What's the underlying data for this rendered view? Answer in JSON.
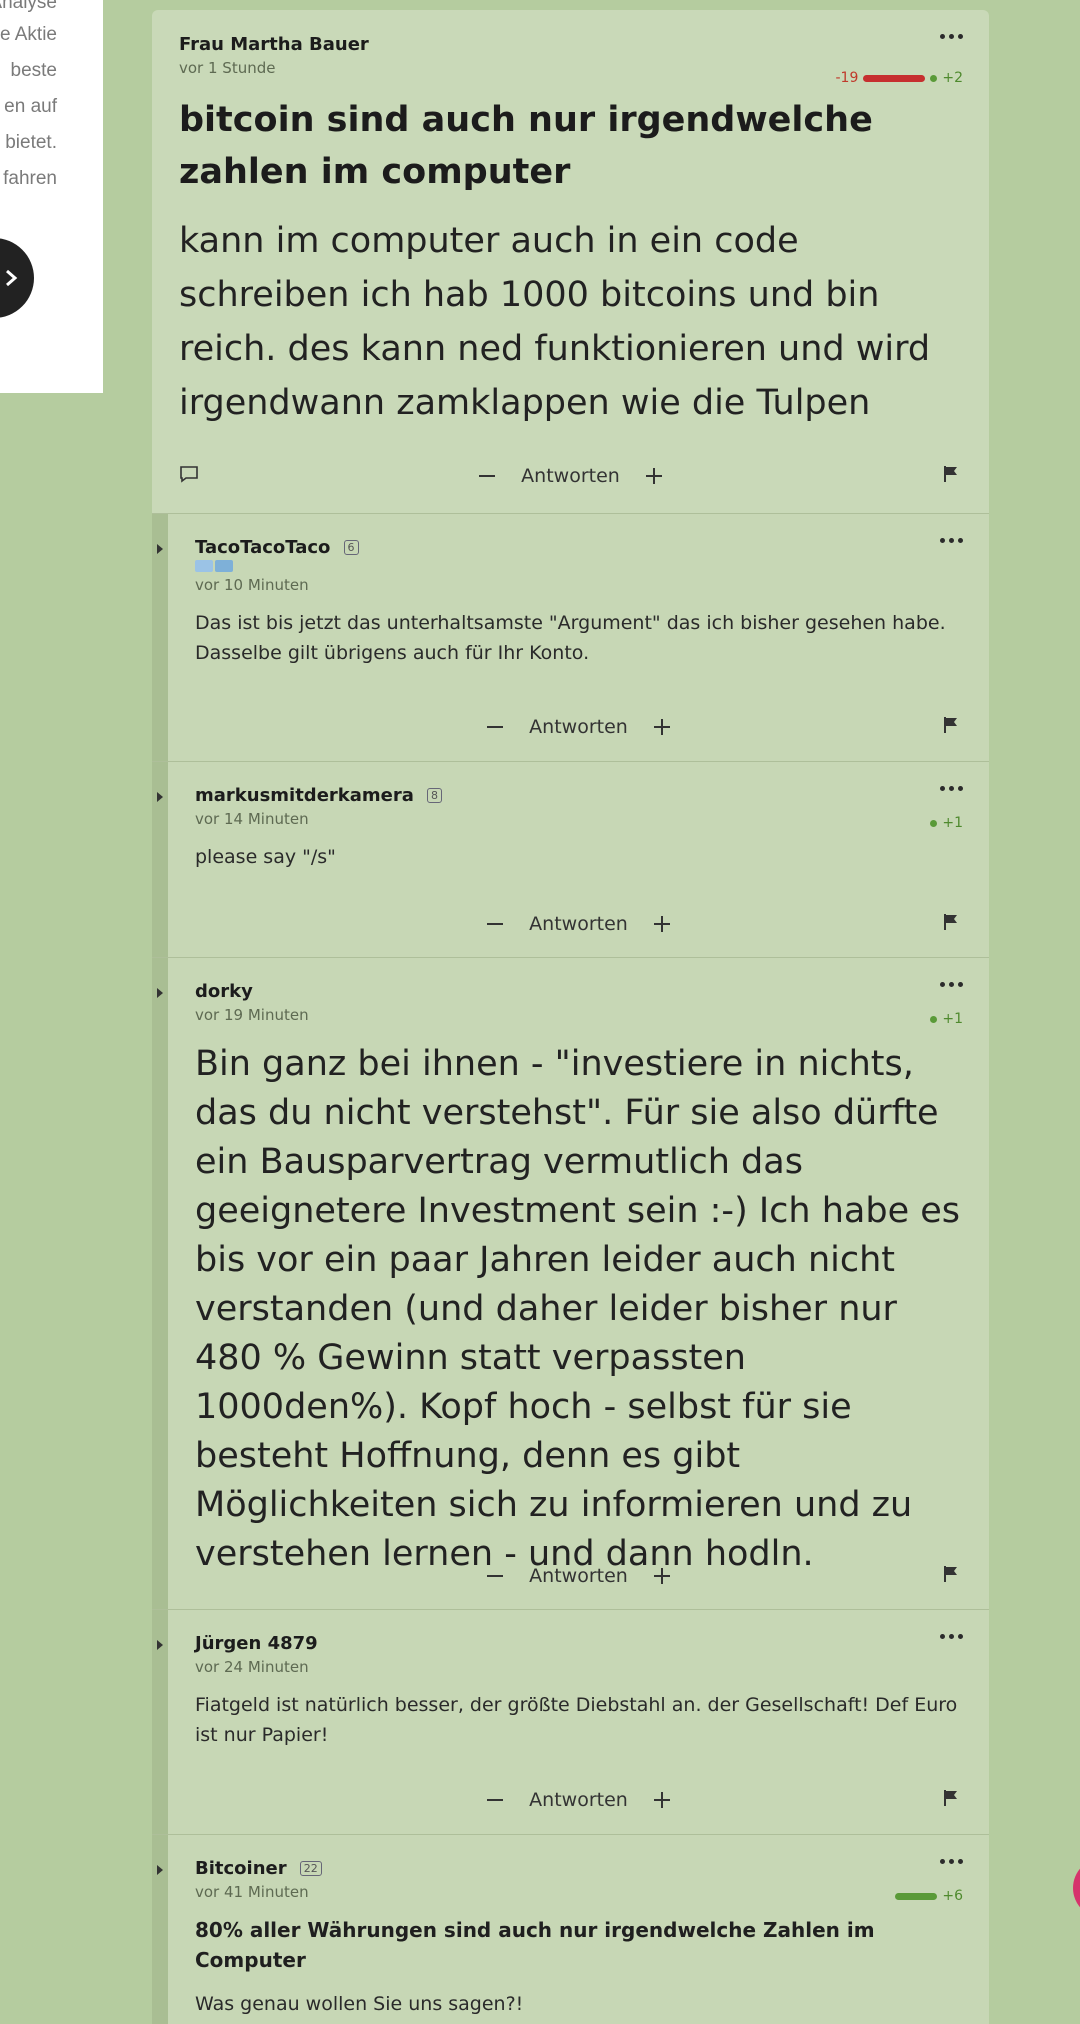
{
  "left_panel": {
    "lines": [
      "Analyse",
      "che Aktie",
      "beste",
      "en auf",
      "e bietet.",
      "fahren"
    ]
  },
  "root": {
    "author": "Frau Martha Bauer",
    "time": "vor 1 Stunde",
    "votes": {
      "negative": "-19",
      "positive": "+2",
      "negative_count": 19,
      "positive_count": 2
    },
    "title": "bitcoin sind auch nur irgendwelche zahlen im computer",
    "body": "kann im computer auch in ein code schreiben ich hab 1000 bitcoins und bin reich. des kann ned funktionieren und wird irgendwann zamklappen wie die Tulpen"
  },
  "actions": {
    "reply_label": "Antworten"
  },
  "comments": [
    {
      "author": "TacoTacoTaco",
      "badge": "6",
      "time": "vor 10 Minuten",
      "body": "Das ist bis jetzt das unterhaltsamste \"Argument\" das ich bisher gesehen habe. Dasselbe gilt übrigens auch für Ihr Konto."
    },
    {
      "author": "markusmitderkamera",
      "badge": "8",
      "time": "vor 14 Minuten",
      "votes": {
        "positive": "+1",
        "positive_count": 1
      },
      "body": "please say \"/s\""
    },
    {
      "author": "dorky",
      "time": "vor 19 Minuten",
      "votes": {
        "positive": "+1",
        "positive_count": 1
      },
      "body": "Bin ganz bei ihnen - \"investiere in nichts, das du nicht verstehst\". Für sie also dürfte ein Bausparvertrag vermutlich das geeignetere Investment sein :-) Ich habe es bis vor ein paar Jahren leider auch nicht verstanden (und daher leider bisher nur 480 % Gewinn statt verpassten 1000den%). Kopf hoch - selbst für sie besteht Hoffnung, denn es gibt Möglichkeiten sich zu informieren und zu verstehen lernen - und dann hodln."
    },
    {
      "author": "Jürgen 4879",
      "time": "vor 24 Minuten",
      "body": "Fiatgeld ist natürlich besser, der größte Diebstahl an. der Gesellschaft! Def Euro ist nur Papier!"
    },
    {
      "author": "Bitcoiner",
      "badge": "22",
      "time": "vor 41 Minuten",
      "votes": {
        "positive": "+6",
        "positive_count": 6
      },
      "title": "80% aller Währungen sind auch nur irgendwelche Zahlen im Computer",
      "body": "Was genau wollen Sie uns sagen?!"
    }
  ],
  "colors": {
    "page_bg": "#b5cc9f",
    "card_bg": "#c9d9b8",
    "vote_negative": "#c62f2f",
    "vote_positive": "#5a9a38"
  }
}
